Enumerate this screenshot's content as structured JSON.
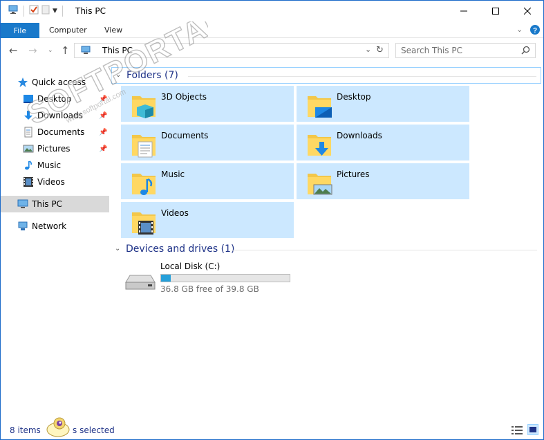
{
  "window": {
    "title": "This PC"
  },
  "ribbon": {
    "tabs": [
      "File",
      "Computer",
      "View"
    ]
  },
  "address": {
    "path": "This PC",
    "search_placeholder": "Search This PC"
  },
  "nav": {
    "quick_access": "Quick access",
    "items": [
      {
        "label": "Desktop",
        "icon": "desktop-icon",
        "pinned": true
      },
      {
        "label": "Downloads",
        "icon": "downloads-icon",
        "pinned": true
      },
      {
        "label": "Documents",
        "icon": "documents-icon",
        "pinned": true
      },
      {
        "label": "Pictures",
        "icon": "pictures-icon",
        "pinned": true
      },
      {
        "label": "Music",
        "icon": "music-icon",
        "pinned": false
      },
      {
        "label": "Videos",
        "icon": "videos-icon",
        "pinned": false
      }
    ],
    "this_pc": "This PC",
    "network": "Network"
  },
  "folders": {
    "header": "Folders (7)",
    "items": [
      {
        "label": "3D Objects",
        "icon": "3d-objects-folder-icon"
      },
      {
        "label": "Desktop",
        "icon": "desktop-folder-icon"
      },
      {
        "label": "Documents",
        "icon": "documents-folder-icon"
      },
      {
        "label": "Downloads",
        "icon": "downloads-folder-icon"
      },
      {
        "label": "Music",
        "icon": "music-folder-icon"
      },
      {
        "label": "Pictures",
        "icon": "pictures-folder-icon"
      },
      {
        "label": "Videos",
        "icon": "videos-folder-icon"
      }
    ]
  },
  "devices": {
    "header": "Devices and drives (1)",
    "drives": [
      {
        "label": "Local Disk (C:)",
        "free_text": "36.8 GB free of 39.8 GB",
        "used_fraction": 0.075
      }
    ]
  },
  "status": {
    "items": "8 items",
    "selected": "s selected"
  },
  "watermark": {
    "text": "SOFTPORTAL",
    "url": "www.softportal.com"
  },
  "colors": {
    "accent": "#1979ca",
    "selection": "#cce8ff",
    "group_header": "#1e3287",
    "drive_fill": "#26a0da"
  }
}
